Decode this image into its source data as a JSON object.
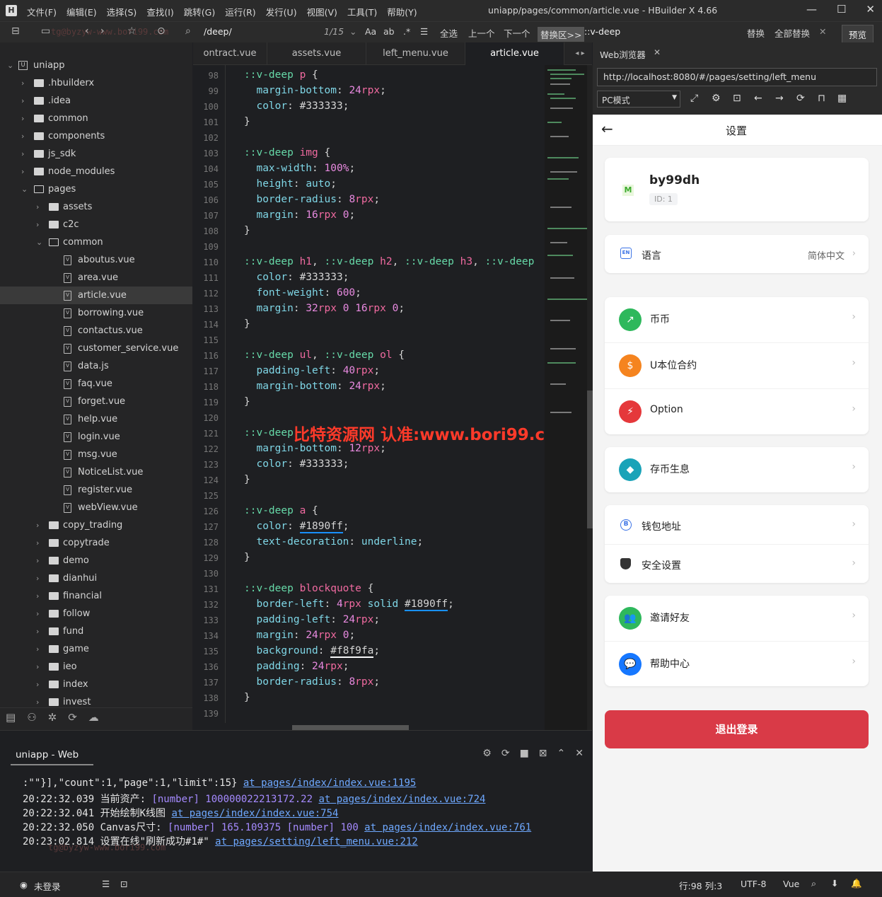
{
  "titlebar": {
    "logo": "H",
    "menus": [
      "文件(F)",
      "编辑(E)",
      "选择(S)",
      "查找(I)",
      "跳转(G)",
      "运行(R)",
      "发行(U)",
      "视图(V)",
      "工具(T)",
      "帮助(Y)"
    ],
    "title": "uniapp/pages/common/article.vue - HBuilder X 4.66"
  },
  "toolbar": {
    "search_value": "/deep/",
    "match_count": "1/15",
    "select_all": "全选",
    "prev": "上一个",
    "next": "下一个",
    "replace_area": "替换区>>",
    "replace_value": "::v-deep",
    "replace": "替换",
    "replace_all": "全部替换",
    "preview": "预览",
    "faint_watermark": "tg@byzyw-www.bori99.com"
  },
  "tree": {
    "root": "uniapp",
    "items": [
      ".hbuilderx",
      ".idea",
      "common",
      "components",
      "js_sdk",
      "node_modules",
      "pages",
      "assets",
      "c2c",
      "common",
      "aboutus.vue",
      "area.vue",
      "article.vue",
      "borrowing.vue",
      "contactus.vue",
      "customer_service.vue",
      "data.js",
      "faq.vue",
      "forget.vue",
      "help.vue",
      "login.vue",
      "msg.vue",
      "NoticeList.vue",
      "register.vue",
      "webView.vue",
      "copy_trading",
      "copytrade",
      "demo",
      "dianhui",
      "financial",
      "follow",
      "fund",
      "game",
      "ieo",
      "index",
      "invest"
    ]
  },
  "tabs": [
    "ontract.vue",
    "assets.vue",
    "left_menu.vue",
    "article.vue"
  ],
  "code": {
    "line_numbers": [
      "98",
      "99",
      "100",
      "101",
      "102",
      "103",
      "104",
      "105",
      "106",
      "107",
      "108",
      "109",
      "110",
      "111",
      "112",
      "113",
      "114",
      "115",
      "116",
      "117",
      "118",
      "119",
      "120",
      "121",
      "122",
      "123",
      "124",
      "125",
      "126",
      "127",
      "128",
      "129",
      "130",
      "131",
      "132",
      "133",
      "134",
      "135",
      "136",
      "137",
      "138",
      "139"
    ]
  },
  "watermark": "比特资源网 认准:www.bori99.com",
  "console": {
    "tab": "uniapp - Web",
    "lines": [
      {
        "text": ":\"\"}],\"count\":1,\"page\":1,\"limit\":15} ",
        "type": "",
        "link": "at pages/index/index.vue:1195"
      },
      {
        "text": "20:22:32.039 当前资产: ",
        "type": "[number]",
        "val": " 100000022213172.22 ",
        "link": "at pages/index/index.vue:724"
      },
      {
        "text": "20:22:32.041 开始绘制K线图 ",
        "type": "",
        "link": "at pages/index/index.vue:754"
      },
      {
        "text": "20:22:32.050 Canvas尺寸: ",
        "type": "[number]",
        "val": " 165.109375 [number] 100 ",
        "link": "at pages/index/index.vue:761"
      },
      {
        "text": "20:23:02.814 设置在线\"刷新成功#1#\" ",
        "type": "",
        "link": "at pages/setting/left_menu.vue:212"
      }
    ],
    "faint": "tg@byzyw-www.bori99.com"
  },
  "status": {
    "login": "未登录",
    "position": "行:98  列:3",
    "encoding": "UTF-8",
    "lang": "Vue"
  },
  "browser": {
    "tab": "Web浏览器",
    "url": "http://localhost:8080/#/pages/setting/left_menu",
    "mode": "PC模式",
    "header_title": "设置",
    "user_name": "by99dh",
    "user_id": "ID: 1",
    "language_label": "语言",
    "language_value": "简体中文",
    "menu1": [
      "币币",
      "U本位合约",
      "Option"
    ],
    "menu2": [
      "存币生息"
    ],
    "menu3": [
      "钱包地址",
      "安全设置"
    ],
    "menu4": [
      "邀请好友",
      "帮助中心"
    ],
    "logout": "退出登录",
    "colors": {
      "logout": "#d93a47",
      "green": "#2eb85c",
      "orange": "#f5841f",
      "red": "#e5383b",
      "teal": "#1aa3b8",
      "blue": "#1677ff"
    }
  }
}
